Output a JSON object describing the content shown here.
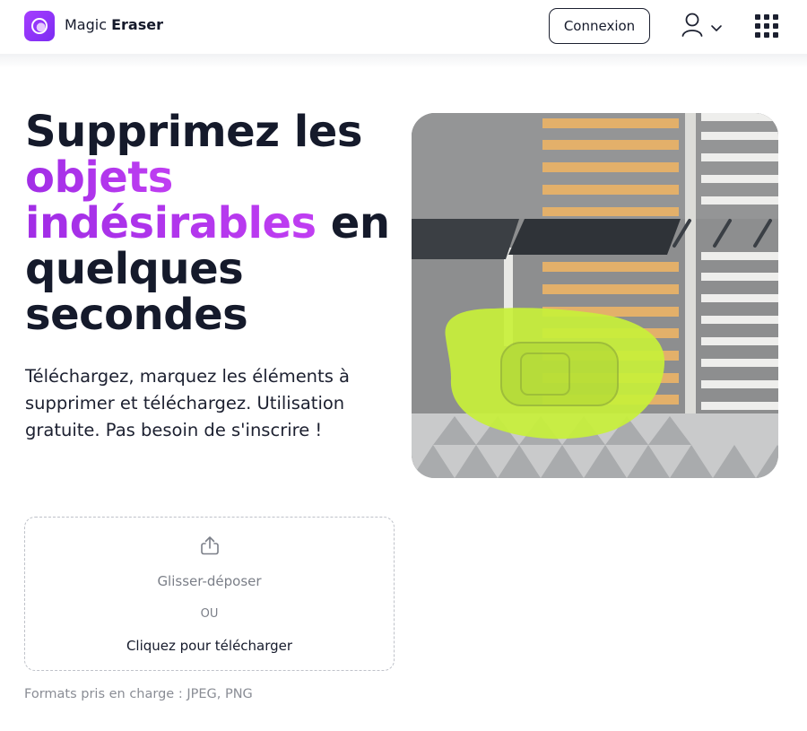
{
  "header": {
    "brand_light": "Magic",
    "brand_bold": "Eraser",
    "login_label": "Connexion",
    "icons": {
      "logo": "magic-eraser-logo",
      "user": "user-icon",
      "chevron": "chevron-down-icon",
      "apps": "apps-grid-icon"
    }
  },
  "hero": {
    "title_line1": "Supprimez les",
    "title_highlight_1": "objets",
    "title_highlight_2": "indésirables",
    "title_after_highlight": " en",
    "title_line4": "quelques",
    "title_line5": "secondes",
    "subtitle": "Téléchargez, marquez les éléments à supprimer et téléchargez. Utilisation gratuite. Pas besoin de s'inscrire !",
    "highlight_color": "#b136ee"
  },
  "upload": {
    "icon": "upload-icon",
    "drag_label": "Glisser-déposer",
    "or_label": "OU",
    "click_label": "Cliquez pour télécharger",
    "formats": "Formats pris en charge : JPEG, PNG"
  },
  "illustration": {
    "mask_color": "#c8f03a"
  }
}
